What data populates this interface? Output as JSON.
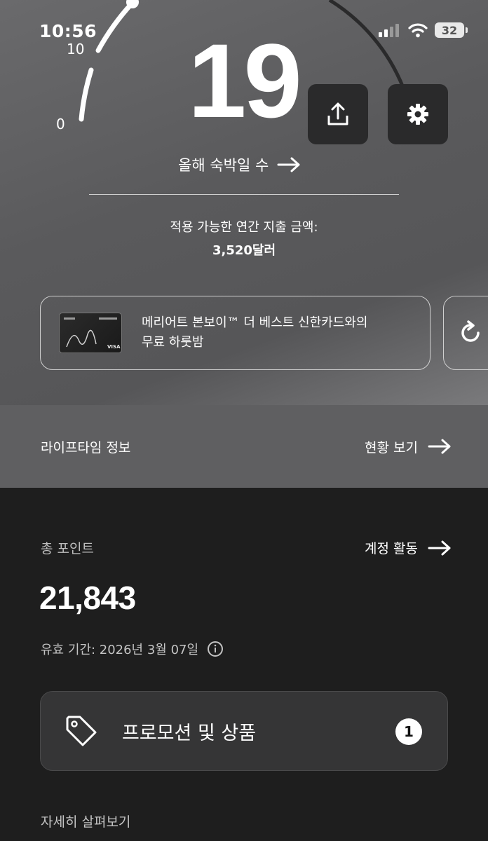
{
  "status_bar": {
    "time": "10:56",
    "battery": "32"
  },
  "gauge": {
    "tick_0": "0",
    "tick_10": "10",
    "value": "19",
    "value_fraction": 0.5
  },
  "actions": {
    "share_icon": "share-icon",
    "settings_icon": "gear-icon"
  },
  "nights": {
    "label": "올해 숙박일 수"
  },
  "spend": {
    "label": "적용 가능한 연간 지출 금액:",
    "value": "3,520달러"
  },
  "card_promo": {
    "line1": "메리어트 본보이™ 더 베스트 신한카드와의",
    "line2": "무료 하룻밤",
    "card_brand": "BONVOY",
    "card_network": "VISA"
  },
  "lifetime": {
    "title": "라이프타임 정보",
    "link": "현황 보기"
  },
  "points": {
    "label": "총 포인트",
    "account_link": "계정 활동",
    "value": "21,843",
    "expiry": "유효 기간: 2026년 3월 07일"
  },
  "promotions": {
    "label": "프로모션 및 상품",
    "badge": "1"
  },
  "explore": {
    "label": "자세히 살펴보기"
  }
}
